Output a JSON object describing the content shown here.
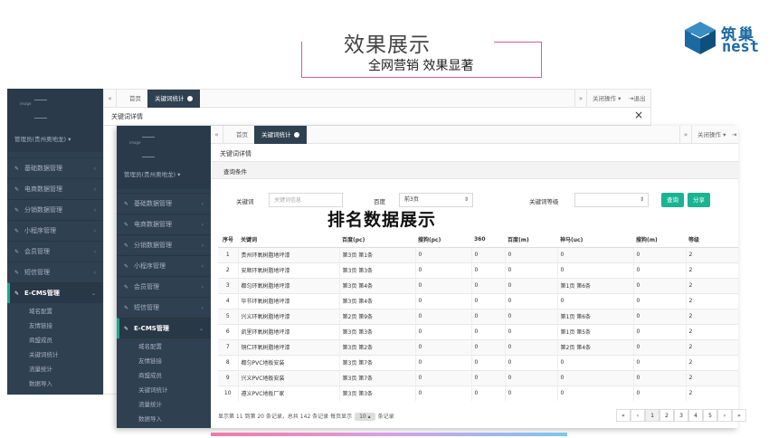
{
  "slide": {
    "title": "效果展示",
    "subtitle": "全网营销 效果显著",
    "overlay": "排名数据展示",
    "logo_cn": "筑巢",
    "logo_en": "nest"
  },
  "back": {
    "tabs": [
      {
        "label": "首页"
      },
      {
        "label": "关键词统计"
      }
    ],
    "close_ops": "关闭操作",
    "logout": "退出",
    "panel_title": "关键词详情",
    "sidebar": {
      "brand_tiny": "image",
      "user": "管理员(贵州奥地龙)",
      "items": [
        {
          "label": "基础数据管理"
        },
        {
          "label": "电商数据管理"
        },
        {
          "label": "分销数据管理"
        },
        {
          "label": "小程序管理"
        },
        {
          "label": "会员管理"
        },
        {
          "label": "短信管理"
        }
      ],
      "open_item": "E-CMS管理",
      "subitems": [
        "域名配置",
        "友情链接",
        "商盟成员",
        "关键词统计",
        "流量统计",
        "数据导入"
      ]
    }
  },
  "front": {
    "tabs": [
      {
        "label": "首页"
      },
      {
        "label": "关键词统计"
      }
    ],
    "close_ops": "关闭操作",
    "panel_title": "关键词详情",
    "query_title": "查询条件",
    "filters": {
      "keyword_label": "关键词",
      "keyword_placeholder": "关键词信息",
      "baidu_label": "百度",
      "baidu_value": "前3页",
      "level_label": "关键词等级",
      "level_value": "",
      "search_btn": "查询",
      "share_btn": "分享"
    },
    "sidebar": {
      "brand_tiny": "image",
      "user": "管理员(贵州奥地龙)",
      "items": [
        {
          "label": "基础数据管理"
        },
        {
          "label": "电商数据管理"
        },
        {
          "label": "分销数据管理"
        },
        {
          "label": "小程序管理"
        },
        {
          "label": "会员管理"
        },
        {
          "label": "短信管理"
        }
      ],
      "open_item": "E-CMS管理",
      "subitems": [
        "域名配置",
        "友情链接",
        "商盟成员",
        "关键词统计",
        "流量统计",
        "数据导入"
      ]
    },
    "table": {
      "columns": [
        "序号",
        "关键词",
        "百度(pc)",
        "搜狗(pc)",
        "360",
        "百度(m)",
        "神马(uc)",
        "搜狗(m)",
        "等级"
      ],
      "rows": [
        [
          "1",
          "贵州环氧树脂地坪漆",
          "第3页 第1条",
          "0",
          "0",
          "0",
          "0",
          "0",
          "2"
        ],
        [
          "2",
          "安顺环氧树脂地坪漆",
          "第3页 第3条",
          "0",
          "0",
          "0",
          "0",
          "0",
          "2"
        ],
        [
          "3",
          "都匀环氧树脂地坪漆",
          "第3页 第4条",
          "0",
          "0",
          "0",
          "第1页 第6条",
          "0",
          "2"
        ],
        [
          "4",
          "毕节环氧树脂地坪漆",
          "第3页 第4条",
          "0",
          "0",
          "0",
          "0",
          "0",
          "2"
        ],
        [
          "5",
          "兴义环氧树脂地坪漆",
          "第2页 第9条",
          "0",
          "0",
          "0",
          "第1页 第6条",
          "0",
          "2"
        ],
        [
          "6",
          "凯里环氧树脂地坪漆",
          "第3页 第3条",
          "0",
          "0",
          "0",
          "第1页 第5条",
          "0",
          "2"
        ],
        [
          "7",
          "铜仁环氧树脂地坪漆",
          "第3页 第2条",
          "0",
          "0",
          "0",
          "第2页 第4条",
          "0",
          "2"
        ],
        [
          "8",
          "都匀PVC地板安装",
          "第3页 第7条",
          "0",
          "0",
          "0",
          "0",
          "0",
          "2"
        ],
        [
          "9",
          "兴义PVC地板安装",
          "第3页 第7条",
          "0",
          "0",
          "0",
          "0",
          "0",
          "2"
        ],
        [
          "10",
          "遵义PVC地板厂家",
          "第3页 第3条",
          "0",
          "0",
          "0",
          "0",
          "0",
          "2"
        ]
      ]
    },
    "pager": {
      "info_before": "显示第 11 到第 20 条记录，总共 142 条记录 每页显示",
      "page_size": "10",
      "info_after": "条记录",
      "buttons": [
        "«",
        "‹",
        "1",
        "2",
        "3",
        "4",
        "5",
        "›",
        "»"
      ]
    }
  }
}
